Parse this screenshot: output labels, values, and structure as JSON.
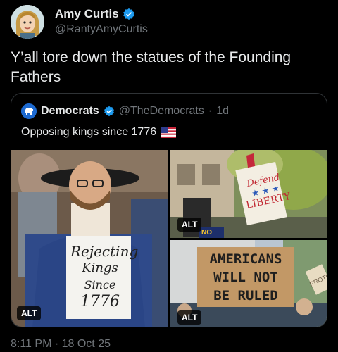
{
  "author": {
    "name": "Amy Curtis",
    "handle": "@RantyAmyCurtis"
  },
  "tweet": {
    "text": "Y’all tore down the statues of the Founding Fathers",
    "timestamp": "8:11 PM · 18 Oct 25"
  },
  "quoted": {
    "name": "Democrats",
    "handle": "@TheDemocrats",
    "separator": "·",
    "time": "1d",
    "text": "Opposing kings since 1776",
    "flag": "us-flag-icon",
    "images": {
      "img1": {
        "alt_label": "ALT",
        "sign": [
          "Rejecting",
          "Kings",
          "Since",
          "1776"
        ]
      },
      "img2": {
        "alt_label": "ALT",
        "sign": [
          "Defend",
          "LIBERTY"
        ],
        "small_sign": "NO"
      },
      "img3": {
        "alt_label": "ALT",
        "sign": [
          "AMERICANS",
          "WILL NOT",
          "BE RULED"
        ],
        "side_sign": "PROTESTS"
      }
    }
  },
  "colors": {
    "background": "#000000",
    "text": "#e7e9ea",
    "muted": "#71767b",
    "border": "#2f3336",
    "verified": "#1d9bf0"
  }
}
